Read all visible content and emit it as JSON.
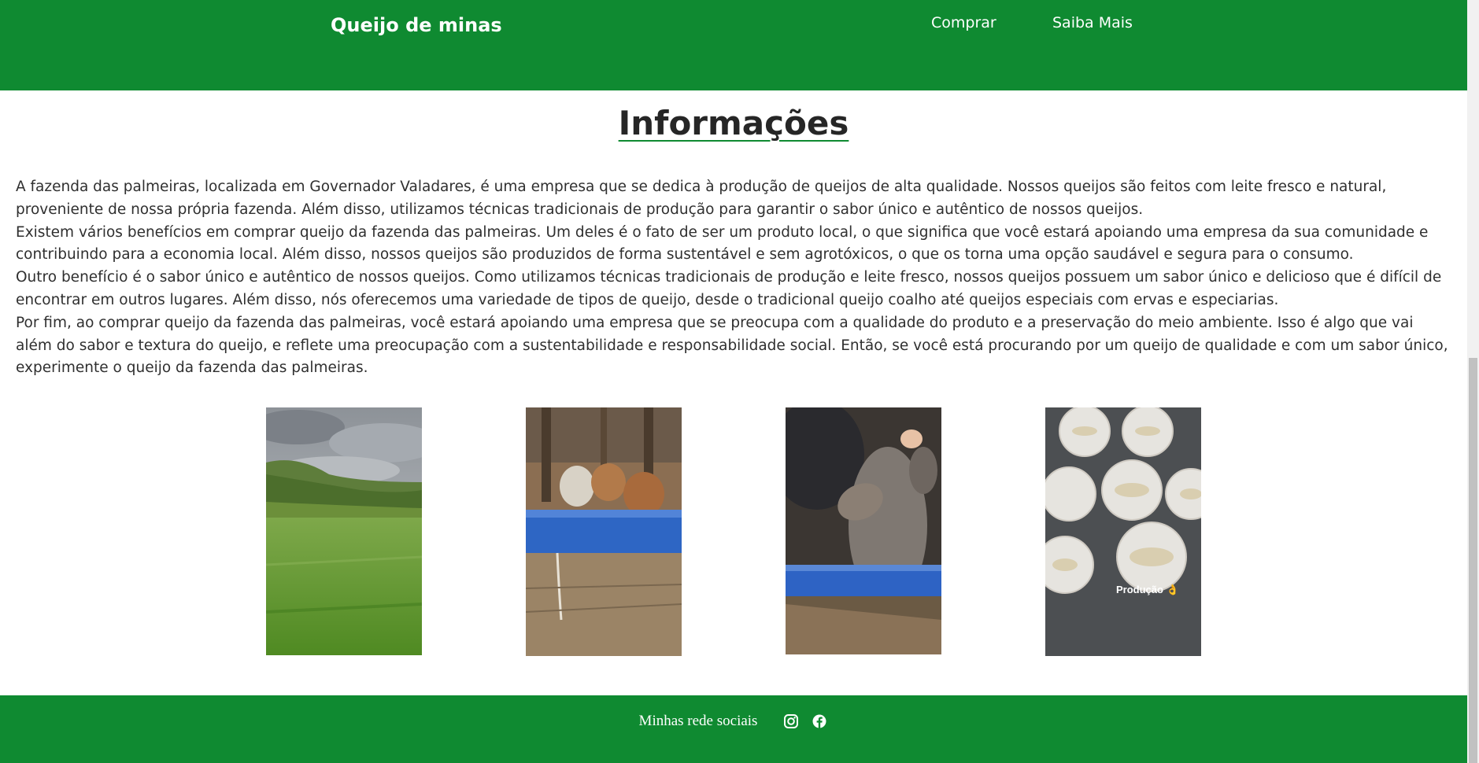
{
  "header": {
    "brand": "Queijo de minas",
    "nav": [
      {
        "label": "Comprar"
      },
      {
        "label": "Saiba Mais"
      }
    ]
  },
  "main": {
    "title": "Informações",
    "paragraphs": [
      "A fazenda das palmeiras, localizada em Governador Valadares, é uma empresa que se dedica à produção de queijos de alta qualidade. Nossos queijos são feitos com leite fresco e natural, proveniente de nossa própria fazenda. Além disso, utilizamos técnicas tradicionais de produção para garantir o sabor único e autêntico de nossos queijos.",
      "Existem vários benefícios em comprar queijo da fazenda das palmeiras. Um deles é o fato de ser um produto local, o que significa que você estará apoiando uma empresa da sua comunidade e contribuindo para a economia local. Além disso, nossos queijos são produzidos de forma sustentável e sem agrotóxicos, o que os torna uma opção saudável e segura para o consumo.",
      "Outro benefício é o sabor único e autêntico de nossos queijos. Como utilizamos técnicas tradicionais de produção e leite fresco, nossos queijos possuem um sabor único e delicioso que é difícil de encontrar em outros lugares. Além disso, nós oferecemos uma variedade de tipos de queijo, desde o tradicional queijo coalho até queijos especiais com ervas e especiarias.",
      "Por fim, ao comprar queijo da fazenda das palmeiras, você estará apoiando uma empresa que se preocupa com a qualidade do produto e a preservação do meio ambiente. Isso é algo que vai além do sabor e textura do queijo, e reflete uma preocupação com a sustentabilidade e responsabilidade social. Então, se você está procurando por um queijo de qualidade e com um sabor único, experimente o queijo da fazenda das palmeiras."
    ],
    "photos": [
      {
        "subject": "green-pasture-hills"
      },
      {
        "subject": "calves-at-trough"
      },
      {
        "subject": "calf-close-up"
      },
      {
        "subject": "cheese-production",
        "caption": "Produção 👌"
      }
    ]
  },
  "footer": {
    "text": "Minhas rede sociais",
    "icons": [
      "instagram-icon",
      "facebook-icon"
    ]
  },
  "colors": {
    "brand_green": "#0f8a31",
    "text": "#2f2f2f",
    "background": "#ffffff"
  }
}
